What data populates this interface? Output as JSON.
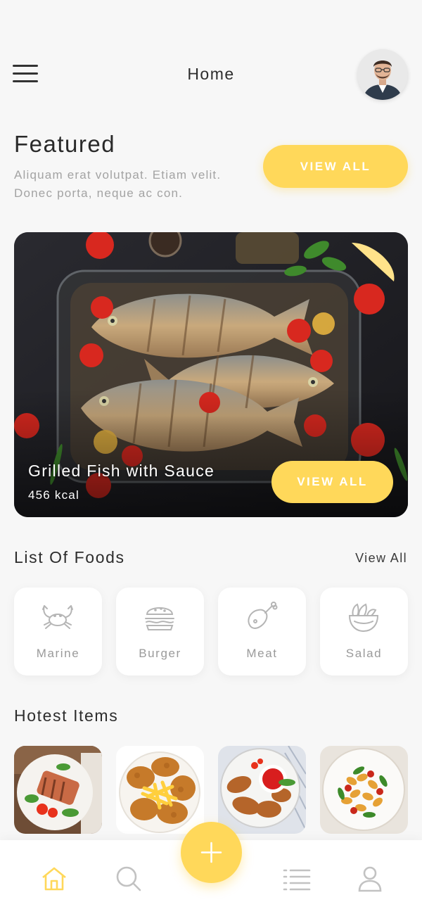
{
  "header": {
    "title": "Home"
  },
  "featured": {
    "title": "Featured",
    "description": "Aliquam erat volutpat. Etiam  velit. Donec porta, neque ac con.",
    "view_all_label": "VIEW ALL"
  },
  "hero": {
    "title": "Grilled Fish with Sauce",
    "kcal": "456 kcal",
    "view_all_label": "VIEW ALL"
  },
  "list_of_foods": {
    "title": "List Of Foods",
    "view_all_label": "View All",
    "categories": [
      {
        "label": "Marine",
        "icon": "crab-icon"
      },
      {
        "label": "Burger",
        "icon": "burger-icon"
      },
      {
        "label": "Meat",
        "icon": "drumstick-icon"
      },
      {
        "label": "Salad",
        "icon": "salad-bowl-icon"
      }
    ]
  },
  "hotest_items": {
    "title": "Hotest Items",
    "items": [
      "grilled-salmon-plate",
      "fried-chicken-fries-plate",
      "roast-chicken-sauce-plate",
      "pasta-plate"
    ]
  },
  "bottom_nav": {
    "items": [
      "home-icon",
      "search-icon",
      "add-icon",
      "list-icon",
      "profile-icon"
    ],
    "active": "home-icon"
  },
  "colors": {
    "accent": "#ffd85a",
    "text": "#2d2d2d",
    "muted": "#a3a3a3",
    "icon": "#b5b5b5"
  }
}
